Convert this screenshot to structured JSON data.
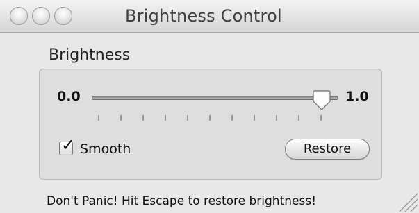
{
  "window": {
    "title": "Brightness Control",
    "controls": [
      "close-button",
      "minimize-button",
      "zoom-button"
    ]
  },
  "brightness_group": {
    "title": "Brightness",
    "slider": {
      "min_label": "0.0",
      "max_label": "1.0",
      "value": 1.0,
      "tick_count": 11
    },
    "smooth": {
      "label": "Smooth",
      "checked": true
    },
    "restore_button_label": "Restore"
  },
  "footer": {
    "text": "Don't Panic!  Hit Escape to restore brightness!"
  },
  "colors": {
    "window_bg": "#e8e8e8",
    "group_bg": "#dedede",
    "text": "#111111"
  }
}
